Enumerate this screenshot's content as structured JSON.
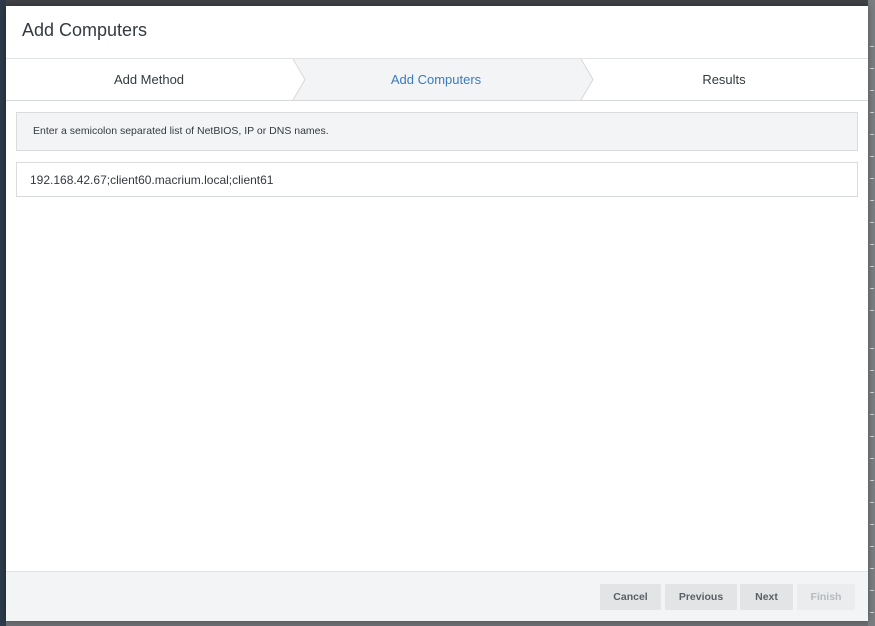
{
  "dialog": {
    "title": "Add Computers"
  },
  "wizard": {
    "steps": [
      {
        "label": "Add Method",
        "state": "completed"
      },
      {
        "label": "Add Computers",
        "state": "active"
      },
      {
        "label": "Results",
        "state": "pending"
      }
    ]
  },
  "main": {
    "instruction": "Enter a semicolon separated list of NetBIOS, IP or DNS names.",
    "names_input": {
      "value": "192.168.42.67;client60.macrium.local;client61",
      "placeholder": ""
    }
  },
  "footer": {
    "cancel_label": "Cancel",
    "previous_label": "Previous",
    "next_label": "Next",
    "finish_label": "Finish",
    "finish_enabled": false
  },
  "colors": {
    "active_step_text": "#3a7bbf",
    "active_step_bg": "#f3f4f5",
    "button_bg": "#e3e4e6",
    "overlay": "#6a6d71"
  }
}
